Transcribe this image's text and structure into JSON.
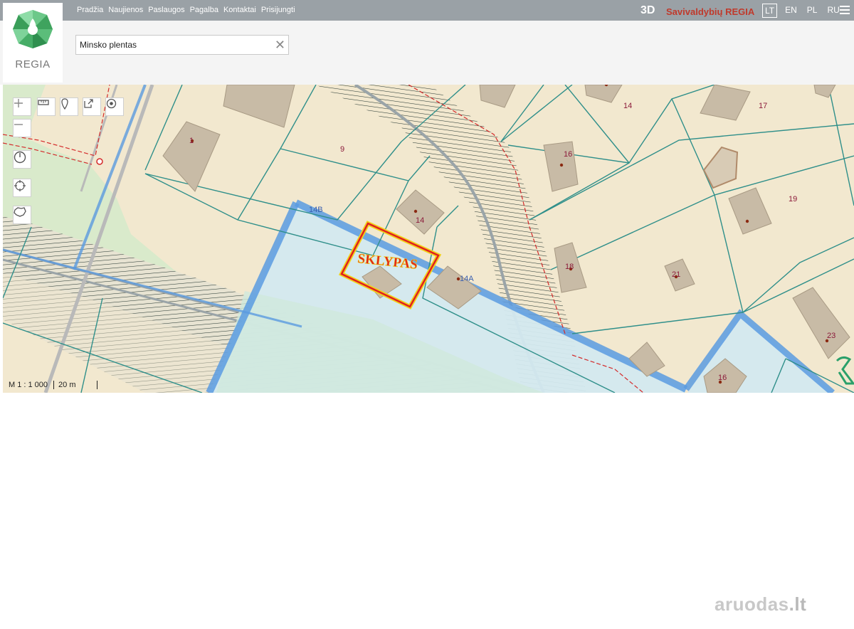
{
  "nav": {
    "items": [
      "Pradžia",
      "Naujienos",
      "Paslaugos",
      "Pagalba",
      "Kontaktai",
      "Prisijungti"
    ]
  },
  "logo": {
    "text": "REGIA"
  },
  "toolbar": {
    "btn_3d": "3D",
    "brand": "Savivaldybių REGIA",
    "languages": [
      "LT",
      "EN",
      "PL",
      "RU"
    ],
    "active_language": "LT"
  },
  "search": {
    "value": "Minsko plentas",
    "clear_label": "✕"
  },
  "map": {
    "highlight_label": "SKLYPAS",
    "plot_numbers": [
      "1",
      "9",
      "14",
      "14B",
      "14A",
      "14",
      "16",
      "17",
      "19",
      "18",
      "21",
      "23",
      "16"
    ],
    "scale_ratio": "M 1 : 1 000",
    "scale_distance": "20 m"
  },
  "watermark": {
    "text": "aruodas",
    "suffix": ".lt"
  },
  "colors": {
    "topbar": "#9aa1a6",
    "brand": "#c0392b",
    "plot_fill": "#f2e8cf",
    "parcel_border": "#2f8f8a",
    "zone_fill": "#d3e9ef",
    "zone_border": "#5b9be0",
    "highlight": "#e02020"
  }
}
